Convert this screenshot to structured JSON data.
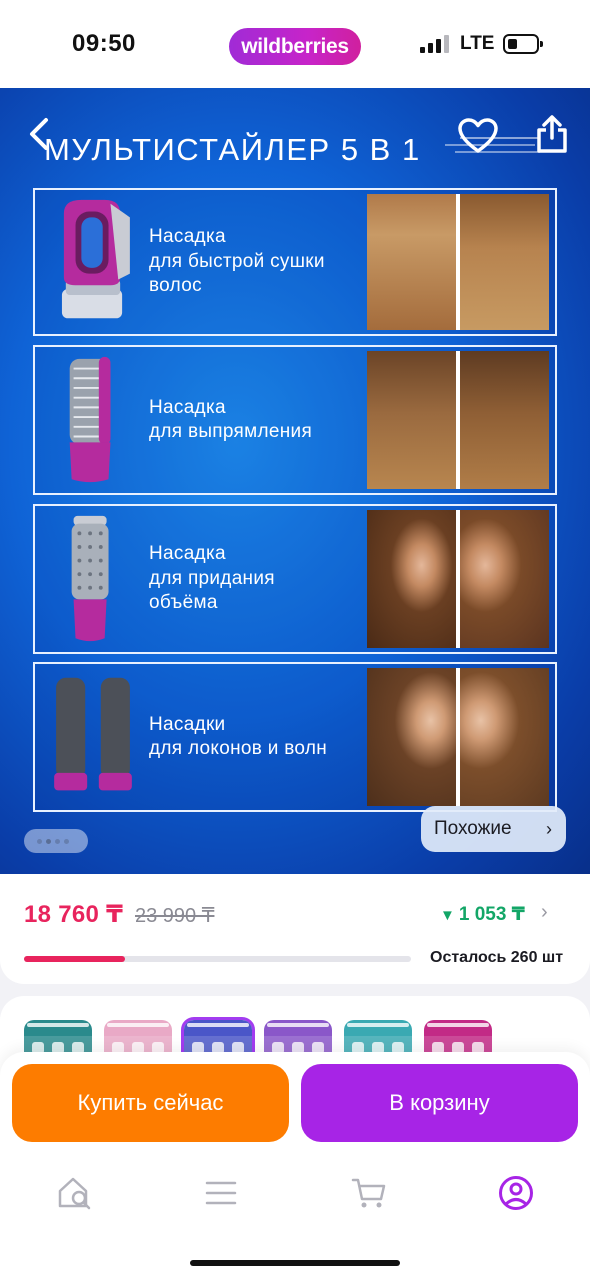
{
  "status_bar": {
    "time": "09:50",
    "brand": "wildberries",
    "network": "LTE"
  },
  "hero": {
    "title": "МУЛЬТИСТАЙЛЕР 5 В 1",
    "features": [
      {
        "lines": [
          "Насадка",
          "для быстрой сушки",
          "волос"
        ],
        "tool": "diffuser-dryer"
      },
      {
        "lines": [
          "Насадка",
          "для выпрямления"
        ],
        "tool": "straightening-brush"
      },
      {
        "lines": [
          "Насадка",
          "для придания",
          "объёма"
        ],
        "tool": "volume-brush"
      },
      {
        "lines": [
          "Насадки",
          "для локонов и волн"
        ],
        "tool": "curling-barrels"
      }
    ],
    "carousel": {
      "total": 4,
      "active": 1
    },
    "similar_label": "Похожие"
  },
  "price": {
    "current": "18 760 ₸",
    "old": "23 990 ₸",
    "cashback": "1 053 ₸",
    "stock_text": "Осталось 260 шт",
    "stock_fraction": 0.26
  },
  "variants": [
    {
      "color": "#2a8a8c"
    },
    {
      "color": "#e9a9c6"
    },
    {
      "color": "#4a56c8",
      "selected": true
    },
    {
      "color": "#8a57c9"
    },
    {
      "color": "#3aa9b2"
    },
    {
      "color": "#c22a86"
    }
  ],
  "actions": {
    "buy_now": "Купить сейчас",
    "add_to_cart": "В корзину"
  },
  "tabs": [
    "home-search",
    "menu",
    "cart",
    "profile"
  ],
  "colors": {
    "accent_purple": "#a724e6",
    "accent_orange": "#fd7c00",
    "price_pink": "#e8245d",
    "cashback_green": "#13a667"
  }
}
